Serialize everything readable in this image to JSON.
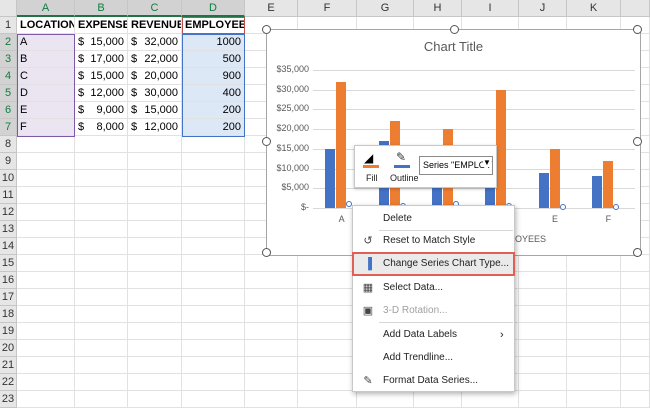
{
  "columns": [
    "A",
    "B",
    "C",
    "D",
    "E",
    "F",
    "G",
    "H",
    "I",
    "J",
    "K"
  ],
  "rows": [
    "1",
    "2",
    "3",
    "4",
    "5",
    "6",
    "7",
    "8",
    "9",
    "10",
    "11",
    "12",
    "13",
    "14",
    "15",
    "16",
    "17",
    "18",
    "19",
    "20",
    "21",
    "22",
    "23"
  ],
  "headers": {
    "location": "LOCATION",
    "expenses": "EXPENSES",
    "revenue": "REVENUE",
    "employees": "EMPLOYEES"
  },
  "currency": "$",
  "table": [
    {
      "location": "A",
      "expenses": "15,000",
      "revenue": "32,000",
      "employees": "1000"
    },
    {
      "location": "B",
      "expenses": "17,000",
      "revenue": "22,000",
      "employees": "500"
    },
    {
      "location": "C",
      "expenses": "15,000",
      "revenue": "20,000",
      "employees": "900"
    },
    {
      "location": "D",
      "expenses": "12,000",
      "revenue": "30,000",
      "employees": "400"
    },
    {
      "location": "E",
      "expenses": "9,000",
      "revenue": "15,000",
      "employees": "200"
    },
    {
      "location": "F",
      "expenses": "8,000",
      "revenue": "12,000",
      "employees": "200"
    }
  ],
  "chart_data": {
    "type": "bar",
    "title": "Chart Title",
    "categories": [
      "A",
      "B",
      "C",
      "D",
      "E",
      "F"
    ],
    "series": [
      {
        "name": "EXPENSES",
        "color": "#4472c4",
        "values": [
          15000,
          17000,
          15000,
          12000,
          9000,
          8000
        ]
      },
      {
        "name": "REVENUE",
        "color": "#ed7d31",
        "values": [
          32000,
          22000,
          20000,
          30000,
          15000,
          12000
        ]
      },
      {
        "name": "EMPLOYEES",
        "color": "#a5a5a5",
        "values": [
          1000,
          500,
          900,
          400,
          200,
          200
        ]
      }
    ],
    "yticks": [
      "$35,000",
      "$30,000",
      "$25,000",
      "$20,000",
      "$15,000",
      "$10,000",
      "$5,000",
      "$-"
    ],
    "ylim": [
      0,
      35000
    ],
    "grid": true,
    "partial_legend_text": "LOYEES"
  },
  "mini_toolbar": {
    "fill": "Fill",
    "outline": "Outline",
    "series_select": "Series \"EMPLOYEES\""
  },
  "context_menu": [
    {
      "label": "Delete",
      "icon": "",
      "disabled": false
    },
    {
      "label": "Reset to Match Style",
      "icon": "reset-style-icon",
      "disabled": false
    },
    {
      "label": "Change Series Chart Type...",
      "icon": "change-chart-type-icon",
      "disabled": false,
      "highlighted": true
    },
    {
      "label": "Select Data...",
      "icon": "select-data-icon",
      "disabled": false
    },
    {
      "label": "3-D Rotation...",
      "icon": "rotation-3d-icon",
      "disabled": true
    },
    {
      "label": "Add Data Labels",
      "icon": "",
      "disabled": false,
      "submenu": true
    },
    {
      "label": "Add Trendline...",
      "icon": "",
      "disabled": false
    },
    {
      "label": "Format Data Series...",
      "icon": "format-series-icon",
      "disabled": false
    }
  ],
  "colors": {
    "accent": "#217346",
    "highlight_border": "#e06055",
    "expenses": "#4472c4",
    "revenue": "#ed7d31"
  }
}
